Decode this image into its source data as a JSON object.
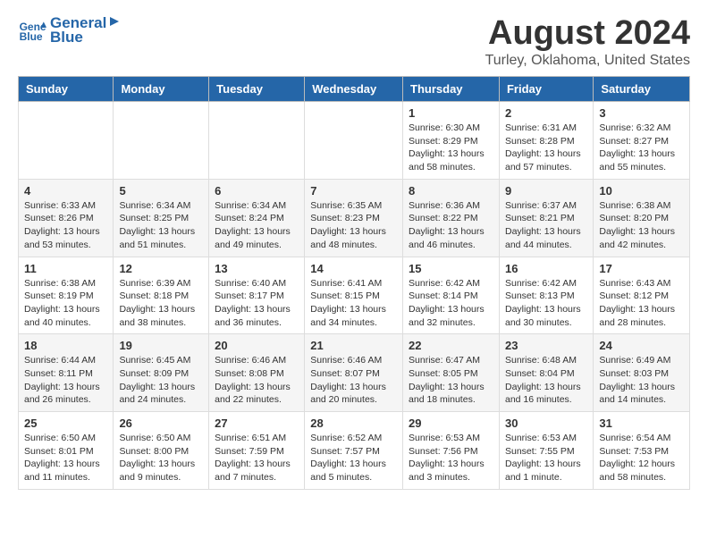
{
  "header": {
    "logo_line1": "General",
    "logo_line2": "Blue",
    "main_title": "August 2024",
    "subtitle": "Turley, Oklahoma, United States"
  },
  "weekdays": [
    "Sunday",
    "Monday",
    "Tuesday",
    "Wednesday",
    "Thursday",
    "Friday",
    "Saturday"
  ],
  "weeks": [
    [
      {
        "day": "",
        "info": ""
      },
      {
        "day": "",
        "info": ""
      },
      {
        "day": "",
        "info": ""
      },
      {
        "day": "",
        "info": ""
      },
      {
        "day": "1",
        "info": "Sunrise: 6:30 AM\nSunset: 8:29 PM\nDaylight: 13 hours\nand 58 minutes."
      },
      {
        "day": "2",
        "info": "Sunrise: 6:31 AM\nSunset: 8:28 PM\nDaylight: 13 hours\nand 57 minutes."
      },
      {
        "day": "3",
        "info": "Sunrise: 6:32 AM\nSunset: 8:27 PM\nDaylight: 13 hours\nand 55 minutes."
      }
    ],
    [
      {
        "day": "4",
        "info": "Sunrise: 6:33 AM\nSunset: 8:26 PM\nDaylight: 13 hours\nand 53 minutes."
      },
      {
        "day": "5",
        "info": "Sunrise: 6:34 AM\nSunset: 8:25 PM\nDaylight: 13 hours\nand 51 minutes."
      },
      {
        "day": "6",
        "info": "Sunrise: 6:34 AM\nSunset: 8:24 PM\nDaylight: 13 hours\nand 49 minutes."
      },
      {
        "day": "7",
        "info": "Sunrise: 6:35 AM\nSunset: 8:23 PM\nDaylight: 13 hours\nand 48 minutes."
      },
      {
        "day": "8",
        "info": "Sunrise: 6:36 AM\nSunset: 8:22 PM\nDaylight: 13 hours\nand 46 minutes."
      },
      {
        "day": "9",
        "info": "Sunrise: 6:37 AM\nSunset: 8:21 PM\nDaylight: 13 hours\nand 44 minutes."
      },
      {
        "day": "10",
        "info": "Sunrise: 6:38 AM\nSunset: 8:20 PM\nDaylight: 13 hours\nand 42 minutes."
      }
    ],
    [
      {
        "day": "11",
        "info": "Sunrise: 6:38 AM\nSunset: 8:19 PM\nDaylight: 13 hours\nand 40 minutes."
      },
      {
        "day": "12",
        "info": "Sunrise: 6:39 AM\nSunset: 8:18 PM\nDaylight: 13 hours\nand 38 minutes."
      },
      {
        "day": "13",
        "info": "Sunrise: 6:40 AM\nSunset: 8:17 PM\nDaylight: 13 hours\nand 36 minutes."
      },
      {
        "day": "14",
        "info": "Sunrise: 6:41 AM\nSunset: 8:15 PM\nDaylight: 13 hours\nand 34 minutes."
      },
      {
        "day": "15",
        "info": "Sunrise: 6:42 AM\nSunset: 8:14 PM\nDaylight: 13 hours\nand 32 minutes."
      },
      {
        "day": "16",
        "info": "Sunrise: 6:42 AM\nSunset: 8:13 PM\nDaylight: 13 hours\nand 30 minutes."
      },
      {
        "day": "17",
        "info": "Sunrise: 6:43 AM\nSunset: 8:12 PM\nDaylight: 13 hours\nand 28 minutes."
      }
    ],
    [
      {
        "day": "18",
        "info": "Sunrise: 6:44 AM\nSunset: 8:11 PM\nDaylight: 13 hours\nand 26 minutes."
      },
      {
        "day": "19",
        "info": "Sunrise: 6:45 AM\nSunset: 8:09 PM\nDaylight: 13 hours\nand 24 minutes."
      },
      {
        "day": "20",
        "info": "Sunrise: 6:46 AM\nSunset: 8:08 PM\nDaylight: 13 hours\nand 22 minutes."
      },
      {
        "day": "21",
        "info": "Sunrise: 6:46 AM\nSunset: 8:07 PM\nDaylight: 13 hours\nand 20 minutes."
      },
      {
        "day": "22",
        "info": "Sunrise: 6:47 AM\nSunset: 8:05 PM\nDaylight: 13 hours\nand 18 minutes."
      },
      {
        "day": "23",
        "info": "Sunrise: 6:48 AM\nSunset: 8:04 PM\nDaylight: 13 hours\nand 16 minutes."
      },
      {
        "day": "24",
        "info": "Sunrise: 6:49 AM\nSunset: 8:03 PM\nDaylight: 13 hours\nand 14 minutes."
      }
    ],
    [
      {
        "day": "25",
        "info": "Sunrise: 6:50 AM\nSunset: 8:01 PM\nDaylight: 13 hours\nand 11 minutes."
      },
      {
        "day": "26",
        "info": "Sunrise: 6:50 AM\nSunset: 8:00 PM\nDaylight: 13 hours\nand 9 minutes."
      },
      {
        "day": "27",
        "info": "Sunrise: 6:51 AM\nSunset: 7:59 PM\nDaylight: 13 hours\nand 7 minutes."
      },
      {
        "day": "28",
        "info": "Sunrise: 6:52 AM\nSunset: 7:57 PM\nDaylight: 13 hours\nand 5 minutes."
      },
      {
        "day": "29",
        "info": "Sunrise: 6:53 AM\nSunset: 7:56 PM\nDaylight: 13 hours\nand 3 minutes."
      },
      {
        "day": "30",
        "info": "Sunrise: 6:53 AM\nSunset: 7:55 PM\nDaylight: 13 hours\nand 1 minute."
      },
      {
        "day": "31",
        "info": "Sunrise: 6:54 AM\nSunset: 7:53 PM\nDaylight: 12 hours\nand 58 minutes."
      }
    ]
  ]
}
